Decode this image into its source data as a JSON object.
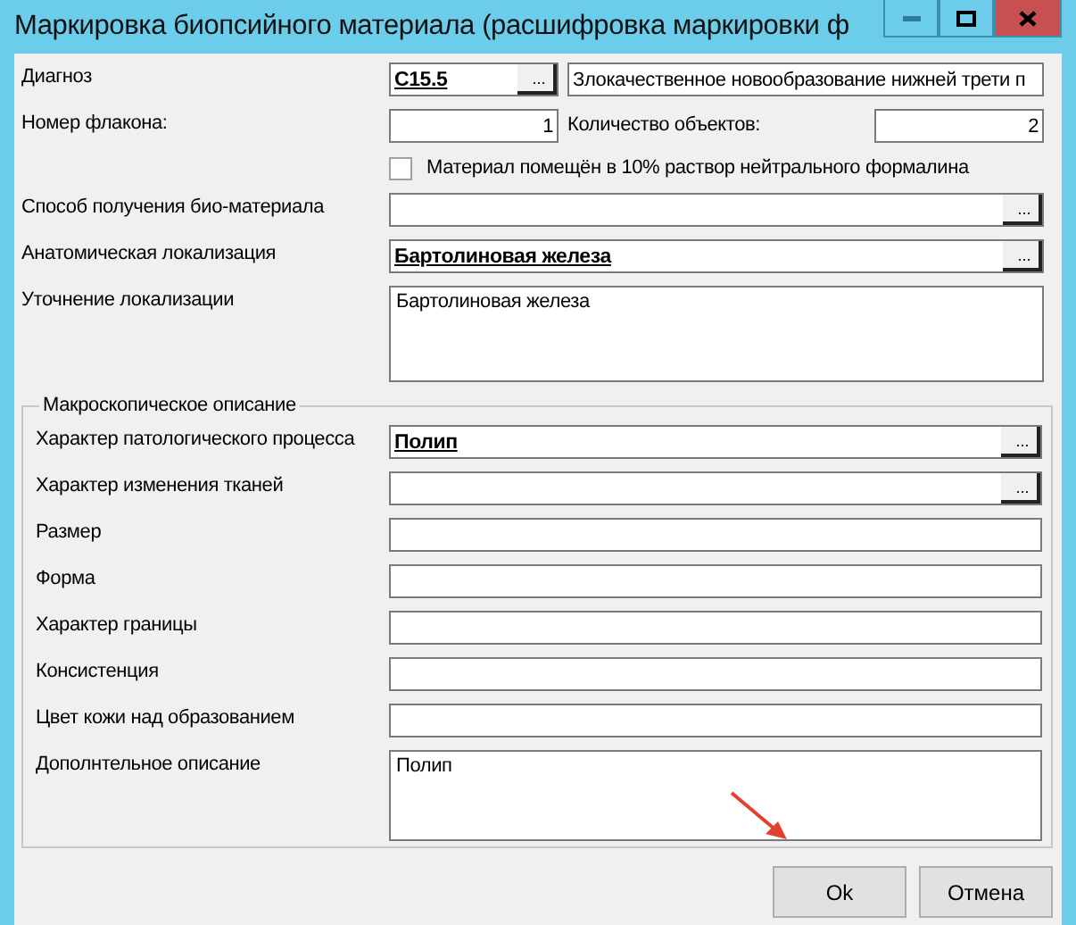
{
  "window": {
    "title": "Маркировка биопсийного материала (расшифровка маркировки ф"
  },
  "window_controls": [
    {
      "kind": "minimize"
    },
    {
      "kind": "maximize"
    },
    {
      "kind": "close"
    }
  ],
  "diagnosis": {
    "label": "Диагноз",
    "code": "C15.5",
    "button": "...",
    "description": "Злокачественное новообразование нижней трети п"
  },
  "vial": {
    "label": "Номер флакона:",
    "value": "1"
  },
  "objects": {
    "label": "Количество объектов:",
    "value": "2"
  },
  "formalin": {
    "label": "Материал помещён в 10% раствор нейтрального формалина",
    "checked": false
  },
  "fields": [
    {
      "kind": "lookup",
      "label": "Способ получения био-материала",
      "button": "..."
    },
    {
      "kind": "lookup",
      "label": "Анатомическая локализация",
      "value": "Бартолиновая железа",
      "button": "..."
    },
    {
      "kind": "memo",
      "label": "Уточнение локализации",
      "value": "Бартолиновая железа"
    }
  ],
  "macro": {
    "title": "Макроскопическое описание",
    "fields": [
      {
        "kind": "lookup",
        "label": "Характер патологического процесса",
        "value": "Полип",
        "button": "..."
      },
      {
        "kind": "lookup",
        "label": "Характер изменения тканей",
        "button": "..."
      },
      {
        "kind": "text",
        "label": "Размер"
      },
      {
        "kind": "text",
        "label": "Форма"
      },
      {
        "kind": "text",
        "label": "Характер границы"
      },
      {
        "kind": "text",
        "label": "Консистенция"
      },
      {
        "kind": "text",
        "label": "Цвет кожи над образованием"
      },
      {
        "kind": "memo",
        "label": "Дополнтельное описание",
        "value": "Полип"
      }
    ]
  },
  "buttons": [
    {
      "label": "Ok"
    },
    {
      "label": "Отмена"
    }
  ]
}
